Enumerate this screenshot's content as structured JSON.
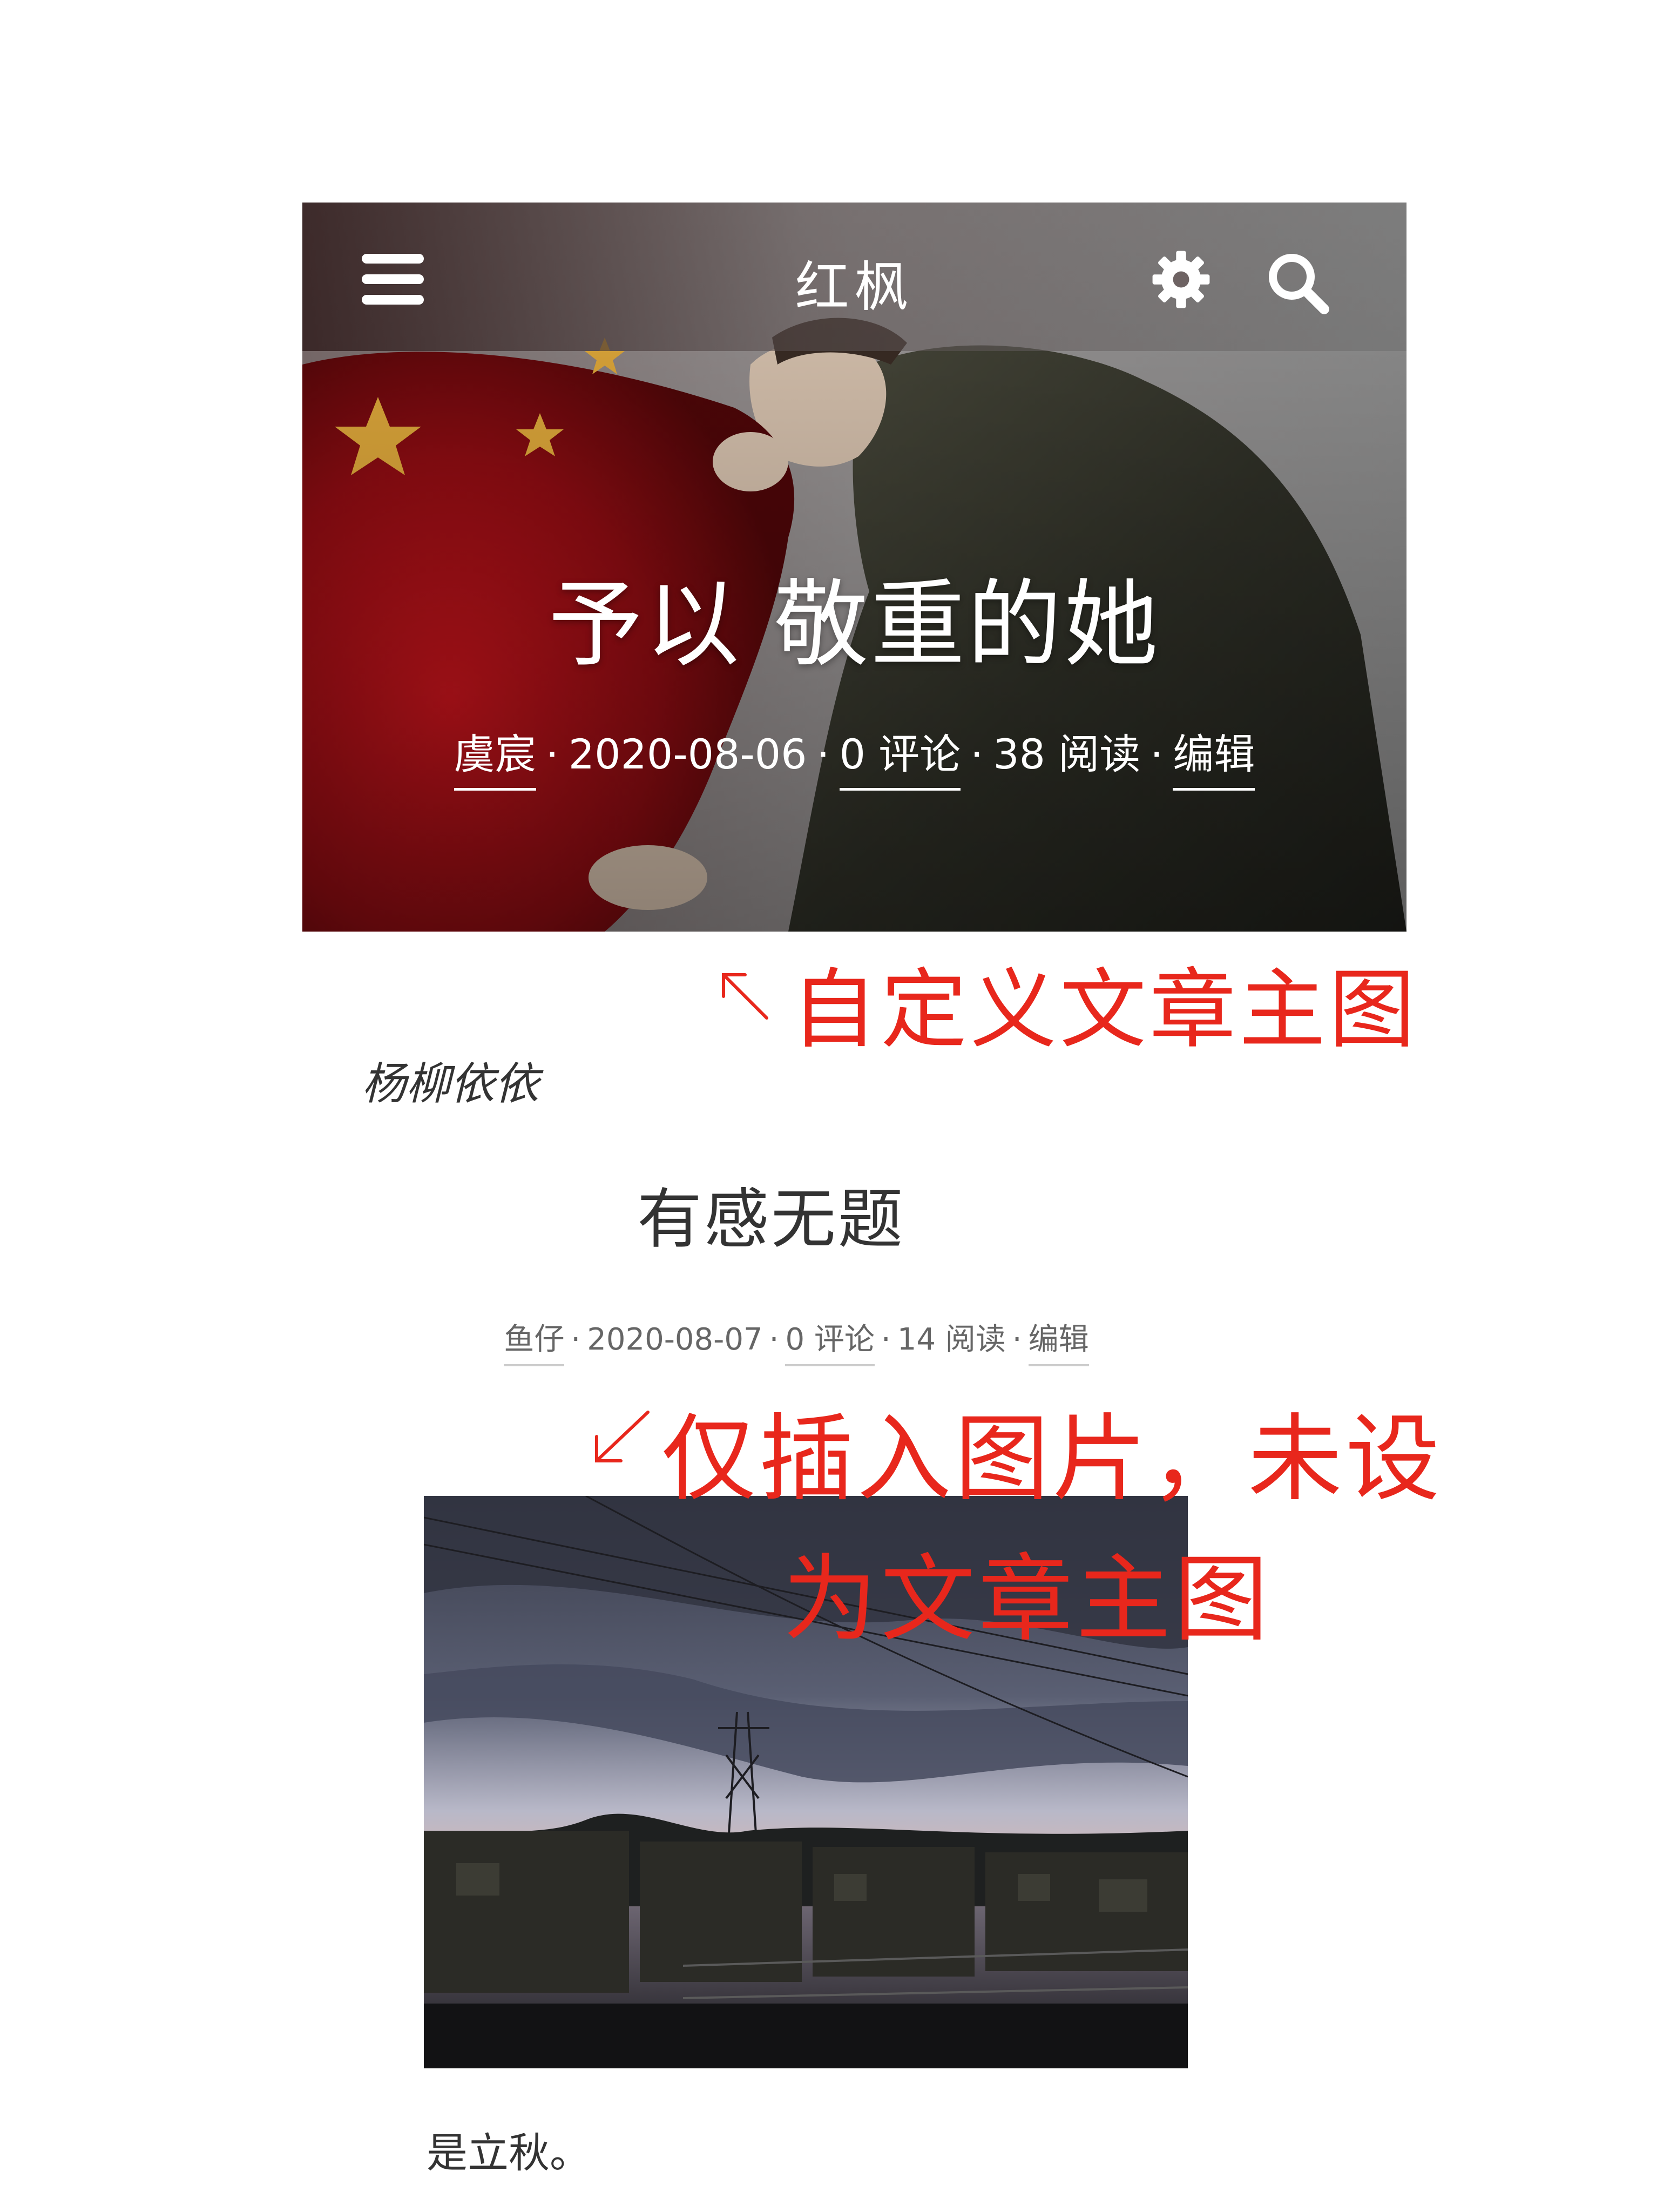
{
  "colors": {
    "annotation": "#e8271c",
    "header_text": "#ffffff",
    "body_text": "#333333",
    "meta_text": "#666666"
  },
  "header": {
    "site_title": "红枫",
    "menu_icon": "hamburger-menu-icon",
    "settings_icon": "gear-icon",
    "search_icon": "search-icon"
  },
  "featured_post": {
    "title": "予以 敬重的她",
    "author": "虞宸",
    "date": "2020-08-06",
    "comments": "0 评论",
    "views": "38 阅读",
    "edit": "编辑"
  },
  "annotations": {
    "custom_image": "自定义文章主图",
    "inserted_only_line1": "仅插入图片，未设",
    "inserted_only_line2": "为文章主图"
  },
  "excerpt_1": "杨柳依依",
  "second_post": {
    "title": "有感无题",
    "author": "鱼仔",
    "date": "2020-08-07",
    "comments": "0 评论",
    "views": "14 阅读",
    "edit": "编辑"
  },
  "excerpt_2": "是立秋。"
}
